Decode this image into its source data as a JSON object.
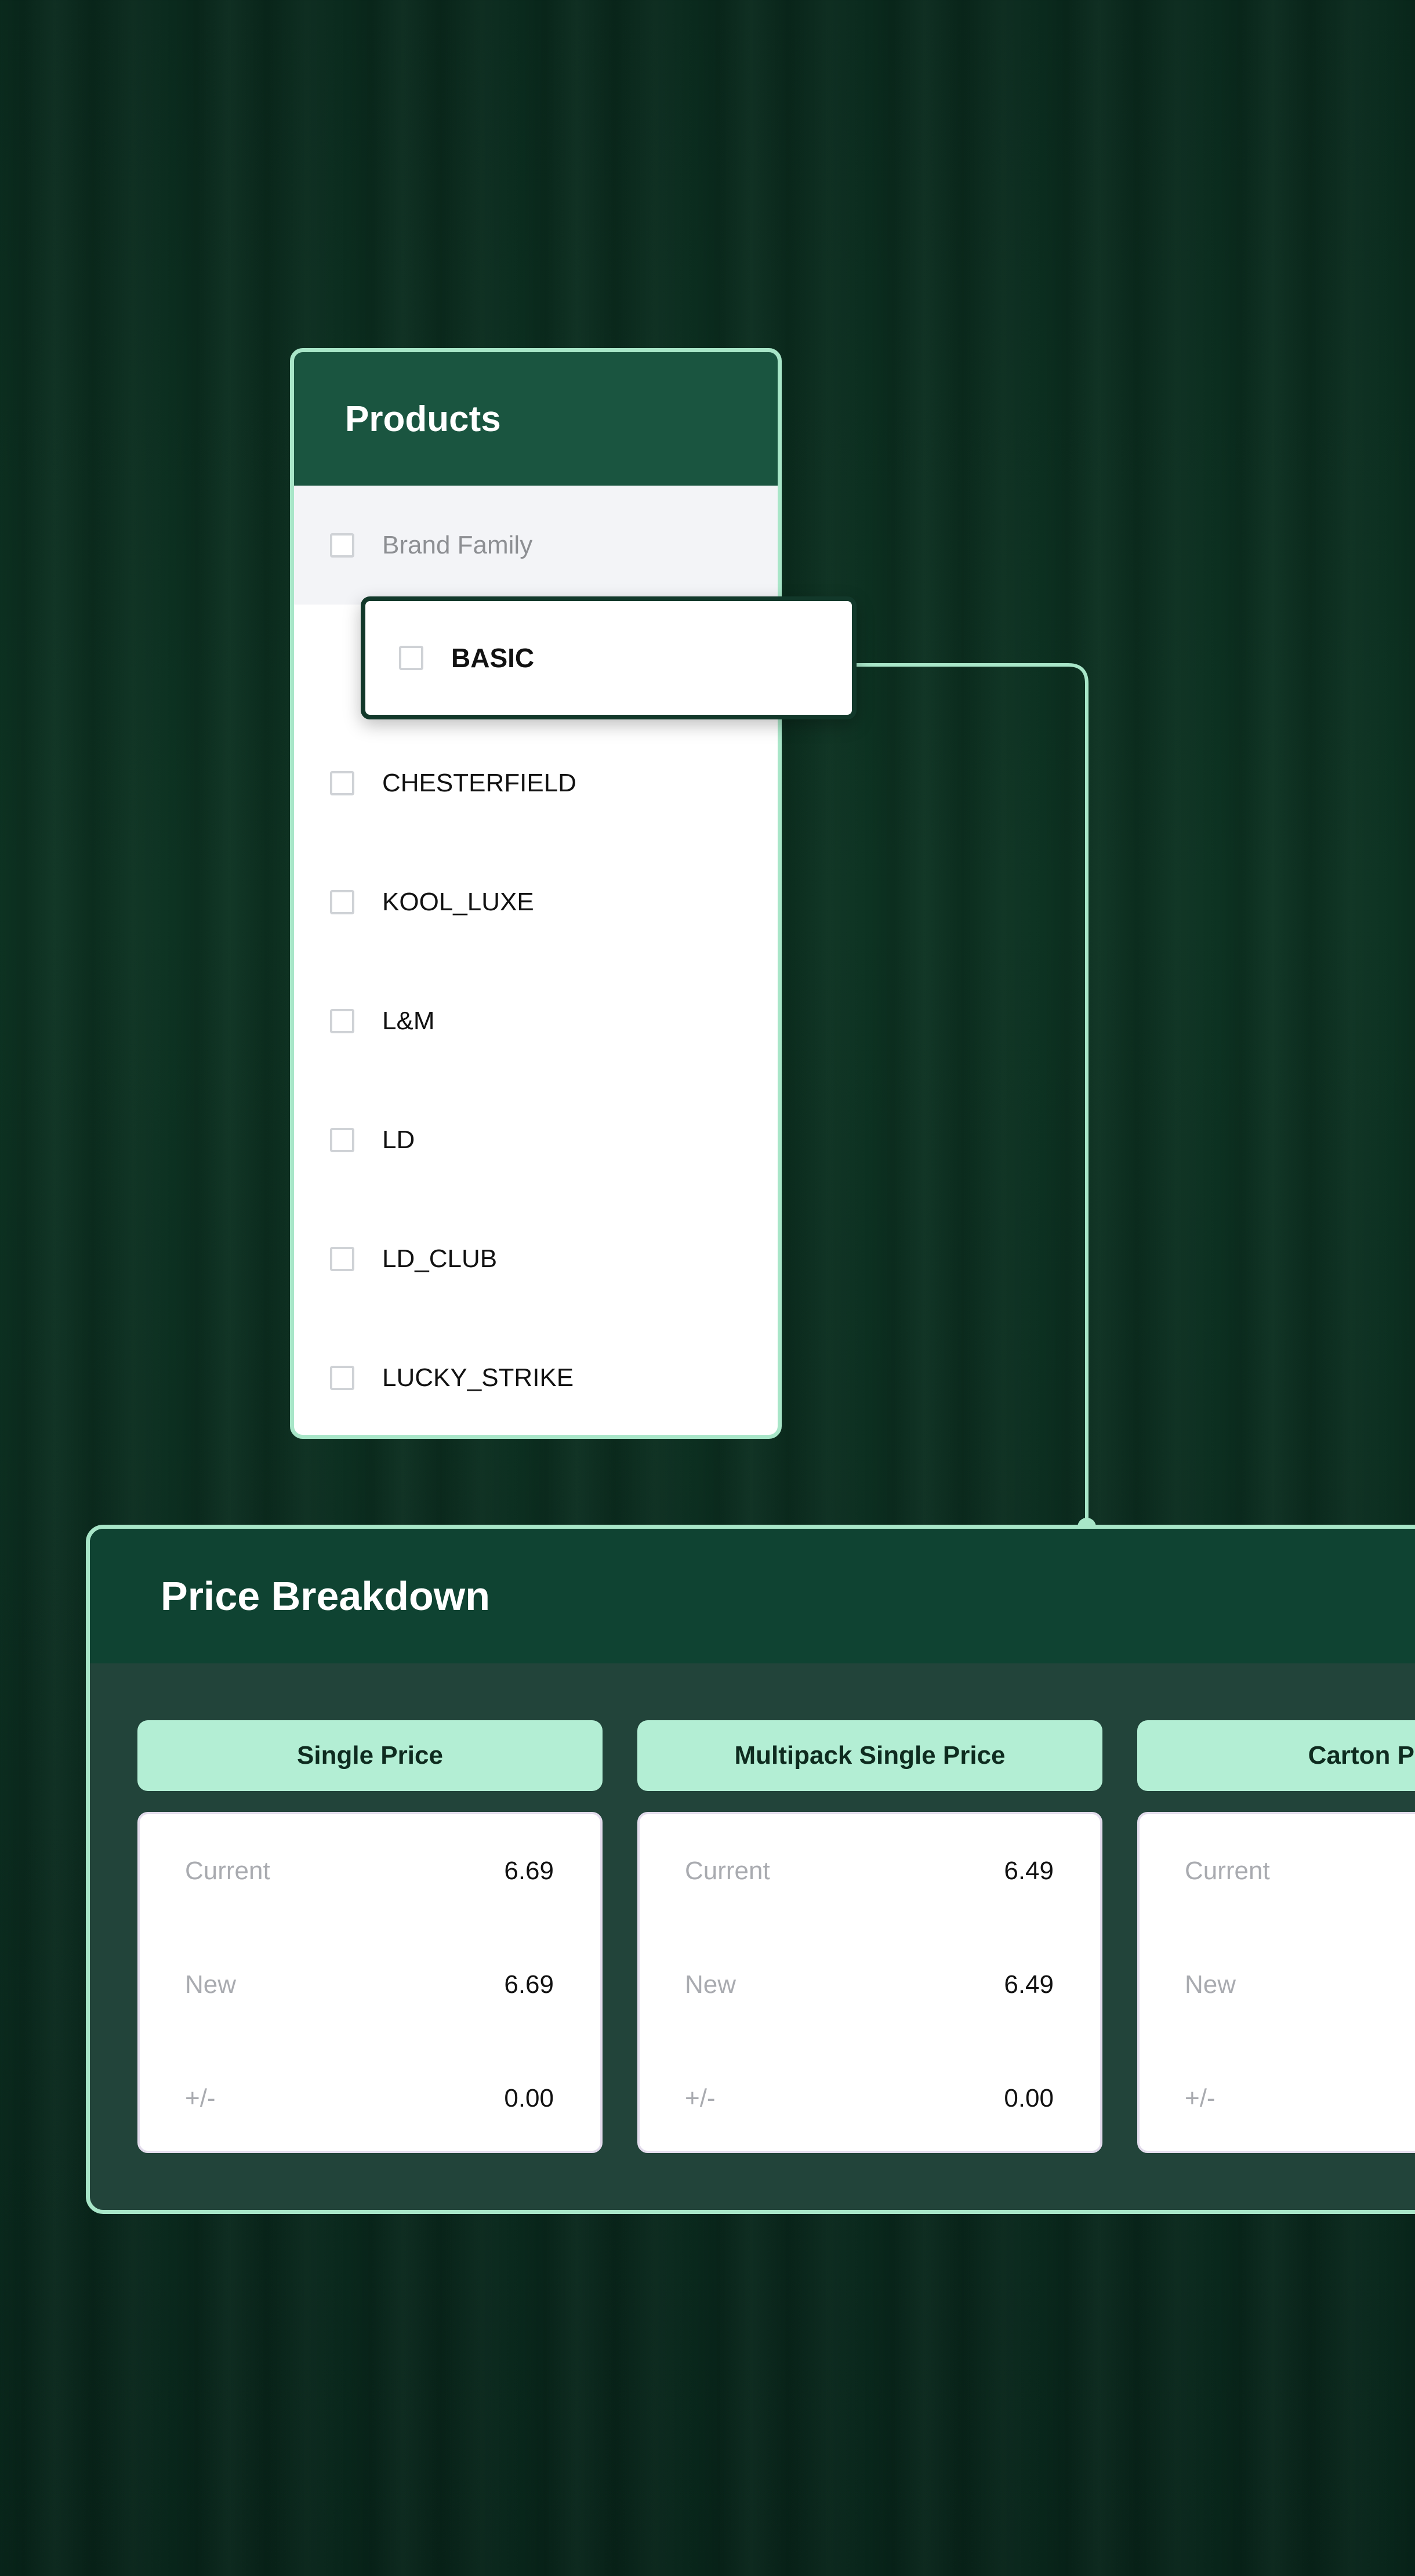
{
  "products": {
    "title": "Products",
    "column_header": "Brand Family",
    "items": [
      {
        "label": "BASIC",
        "highlighted": true
      },
      {
        "label": "CHESTERFIELD"
      },
      {
        "label": "KOOL_LUXE"
      },
      {
        "label": "L&M"
      },
      {
        "label": "LD"
      },
      {
        "label": "LD_CLUB"
      },
      {
        "label": "LUCKY_STRIKE"
      }
    ]
  },
  "price_breakdown": {
    "title": "Price Breakdown",
    "columns": [
      {
        "tab": "Single Price",
        "current_label": "Current",
        "current": "6.69",
        "new_label": "New",
        "new": "6.69",
        "diff_label": "+/-",
        "diff": "0.00"
      },
      {
        "tab": "Multipack Single Price",
        "current_label": "Current",
        "current": "6.49",
        "new_label": "New",
        "new": "6.49",
        "diff_label": "+/-",
        "diff": "0.00"
      },
      {
        "tab": "Carton Pri",
        "current_label": "Current",
        "current": "",
        "new_label": "New",
        "new": "",
        "diff_label": "+/-",
        "diff": ""
      }
    ]
  },
  "colors": {
    "background": "#0c2f21",
    "panel_header": "#1a5540",
    "price_header": "#0f4332",
    "accent_border": "#a8e6c8",
    "tab_fill": "#b3eed4",
    "highlight_border": "#12382a"
  }
}
